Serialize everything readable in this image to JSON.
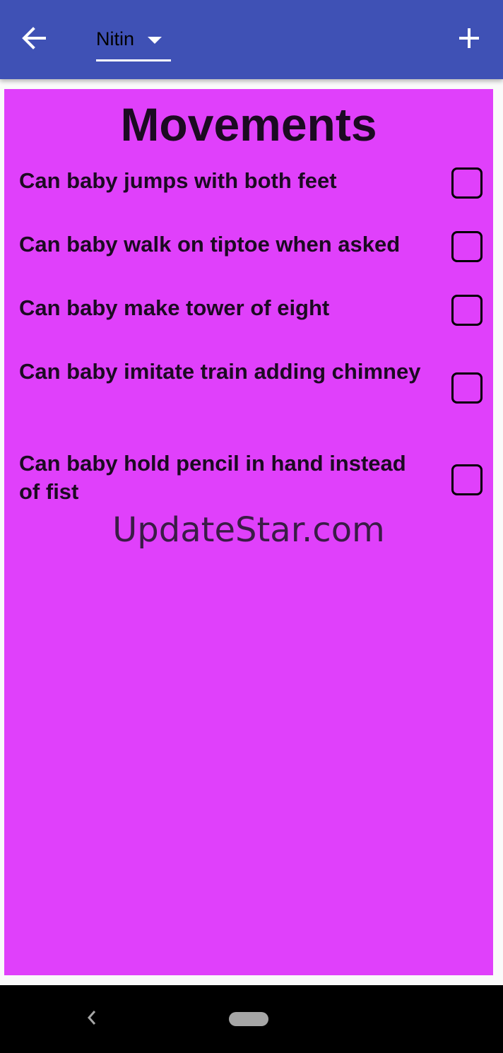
{
  "appbar": {
    "color": "#3f51b5",
    "back_icon": "arrow-left-icon",
    "profile_dropdown": {
      "selected": "Nitin",
      "icon": "caret-down-icon"
    },
    "add_icon": "plus-icon"
  },
  "card": {
    "color": "#e040fb",
    "title": "Movements",
    "items": [
      {
        "label": "Can baby jumps with both feet",
        "checked": false
      },
      {
        "label": "Can baby walk on tiptoe when asked",
        "checked": false
      },
      {
        "label": "Can baby make tower of eight",
        "checked": false
      },
      {
        "label": "Can baby imitate train adding chimney",
        "checked": false
      },
      {
        "label": "Can baby hold pencil in hand instead of fist",
        "checked": false
      }
    ],
    "watermark": "UpdateStar.com"
  },
  "navbar": {
    "back_icon": "chevron-left-icon",
    "home_icon": "home-pill-icon"
  }
}
